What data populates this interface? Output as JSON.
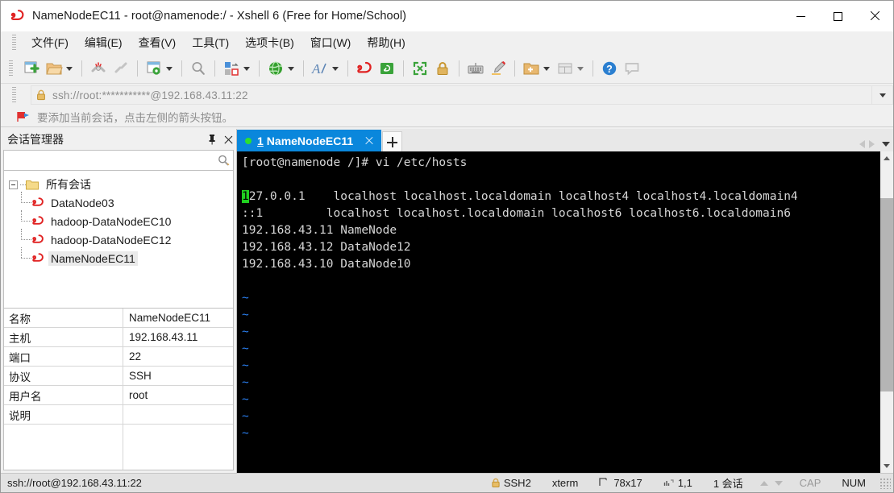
{
  "window": {
    "title": "NameNodeEC11 - root@namenode:/ - Xshell 6 (Free for Home/School)",
    "app_icon": "xshell-snail-icon",
    "minimize_label": "Minimize",
    "maximize_label": "Maximize",
    "close_label": "Close"
  },
  "menubar": {
    "items": [
      {
        "label": "文件(F)",
        "name": "menu-file"
      },
      {
        "label": "编辑(E)",
        "name": "menu-edit"
      },
      {
        "label": "查看(V)",
        "name": "menu-view"
      },
      {
        "label": "工具(T)",
        "name": "menu-tools"
      },
      {
        "label": "选项卡(B)",
        "name": "menu-tabs"
      },
      {
        "label": "窗口(W)",
        "name": "menu-window"
      },
      {
        "label": "帮助(H)",
        "name": "menu-help"
      }
    ]
  },
  "toolbar": {
    "items": [
      {
        "name": "new-session-icon",
        "tip": "新建会话"
      },
      {
        "name": "open-folder-icon",
        "tip": "打开"
      },
      {
        "name": "disconnect-icon",
        "tip": "断开"
      },
      {
        "name": "reconnect-icon",
        "tip": "重新连接"
      },
      {
        "name": "session-properties-icon",
        "tip": "属性"
      },
      {
        "name": "find-icon",
        "tip": "查找"
      },
      {
        "name": "layout-icon",
        "tip": "排列"
      },
      {
        "name": "globe-icon",
        "tip": "编码"
      },
      {
        "name": "font-icon",
        "tip": "字体"
      },
      {
        "name": "xshell-snail-icon",
        "tip": "Xshell"
      },
      {
        "name": "xftp-icon",
        "tip": "Xftp"
      },
      {
        "name": "fullscreen-icon",
        "tip": "全屏"
      },
      {
        "name": "lock-icon",
        "tip": "锁定"
      },
      {
        "name": "keyboard-icon",
        "tip": "键盘"
      },
      {
        "name": "highlight-icon",
        "tip": "高亮"
      },
      {
        "name": "add-folder-icon",
        "tip": "添加"
      },
      {
        "name": "split-view-icon",
        "tip": "窗口布局"
      },
      {
        "name": "help-icon",
        "tip": "帮助"
      },
      {
        "name": "feedback-icon",
        "tip": "反馈"
      }
    ]
  },
  "address_bar": {
    "value": "ssh://root:***********@192.168.43.11:22",
    "lock_icon": "lock-icon",
    "dropdown_icon": "chevron-down-icon"
  },
  "notice_bar": {
    "icon": "red-flag-icon",
    "text": "要添加当前会话，点击左侧的箭头按钮。"
  },
  "sidebar": {
    "title": "会话管理器",
    "pin_icon": "pin-icon",
    "close_icon": "close-icon",
    "search": {
      "value": "",
      "placeholder": "",
      "icon": "search-icon"
    },
    "tree": {
      "root": {
        "label": "所有会话",
        "icon": "folder-icon",
        "expanded": true
      },
      "items": [
        {
          "label": "DataNode03",
          "icon": "session-icon",
          "selected": false
        },
        {
          "label": "hadoop-DataNodeEC10",
          "icon": "session-icon",
          "selected": false
        },
        {
          "label": "hadoop-DataNodeEC12",
          "icon": "session-icon",
          "selected": false
        },
        {
          "label": "NameNodeEC11",
          "icon": "session-icon",
          "selected": true
        }
      ]
    },
    "properties": [
      {
        "key": "名称",
        "value": "NameNodeEC11"
      },
      {
        "key": "主机",
        "value": "192.168.43.11"
      },
      {
        "key": "端口",
        "value": "22"
      },
      {
        "key": "协议",
        "value": "SSH"
      },
      {
        "key": "用户名",
        "value": "root"
      },
      {
        "key": "说明",
        "value": ""
      }
    ]
  },
  "tabs": {
    "active": {
      "number": "1",
      "label": "NameNodeEC11",
      "status_dot": "#2ee02e",
      "close_icon": "close-icon"
    },
    "new_tab_icon": "plus-icon",
    "nav_prev_icon": "chevron-left-icon",
    "nav_next_icon": "chevron-right-icon",
    "nav_menu_icon": "chevron-down-icon"
  },
  "terminal": {
    "prompt_line": "[root@namenode /]# vi /etc/hosts",
    "cursor_char": "1",
    "lines": [
      {
        "text": "27.0.0.1    localhost localhost.localdomain localhost4 localhost4.localdomain4",
        "color": "#d6d6d6"
      },
      {
        "text": "::1         localhost localhost.localdomain localhost6 localhost6.localdomain6",
        "color": "#d6d6d6"
      },
      {
        "text": "192.168.43.11 NameNode",
        "color": "#d6d6d6"
      },
      {
        "text": "192.168.43.12 DataNode12",
        "color": "#d6d6d6"
      },
      {
        "text": "192.168.43.10 DataNode10",
        "color": "#d6d6d6"
      }
    ],
    "tilde_rows": [
      "~",
      "~",
      "~",
      "~",
      "~",
      "~",
      "~",
      "~",
      "~"
    ],
    "tilde_color": "#2a7ff0",
    "background": "#000000",
    "foreground": "#d6d6d6",
    "cursor_color": "#20d020"
  },
  "statusbar": {
    "connection": "ssh://root@192.168.43.11:22",
    "protocol": "SSH2",
    "protocol_icon": "lock-icon",
    "terminal_type": "xterm",
    "size": "78x17",
    "size_icon": "resize-icon",
    "cursor_pos": "1,1",
    "cursor_icon": "cursor-icon",
    "session_count": "1 会话",
    "transfer_up_icon": "arrow-up-icon",
    "transfer_down_icon": "arrow-down-icon",
    "caps": "CAP",
    "num": "NUM",
    "resize_grip_icon": "resize-grip-icon"
  },
  "colors": {
    "accent": "#0a87dc",
    "window_bg": "#f0f0f0",
    "terminal_bg": "#000000",
    "status_green": "#2ee02e"
  }
}
